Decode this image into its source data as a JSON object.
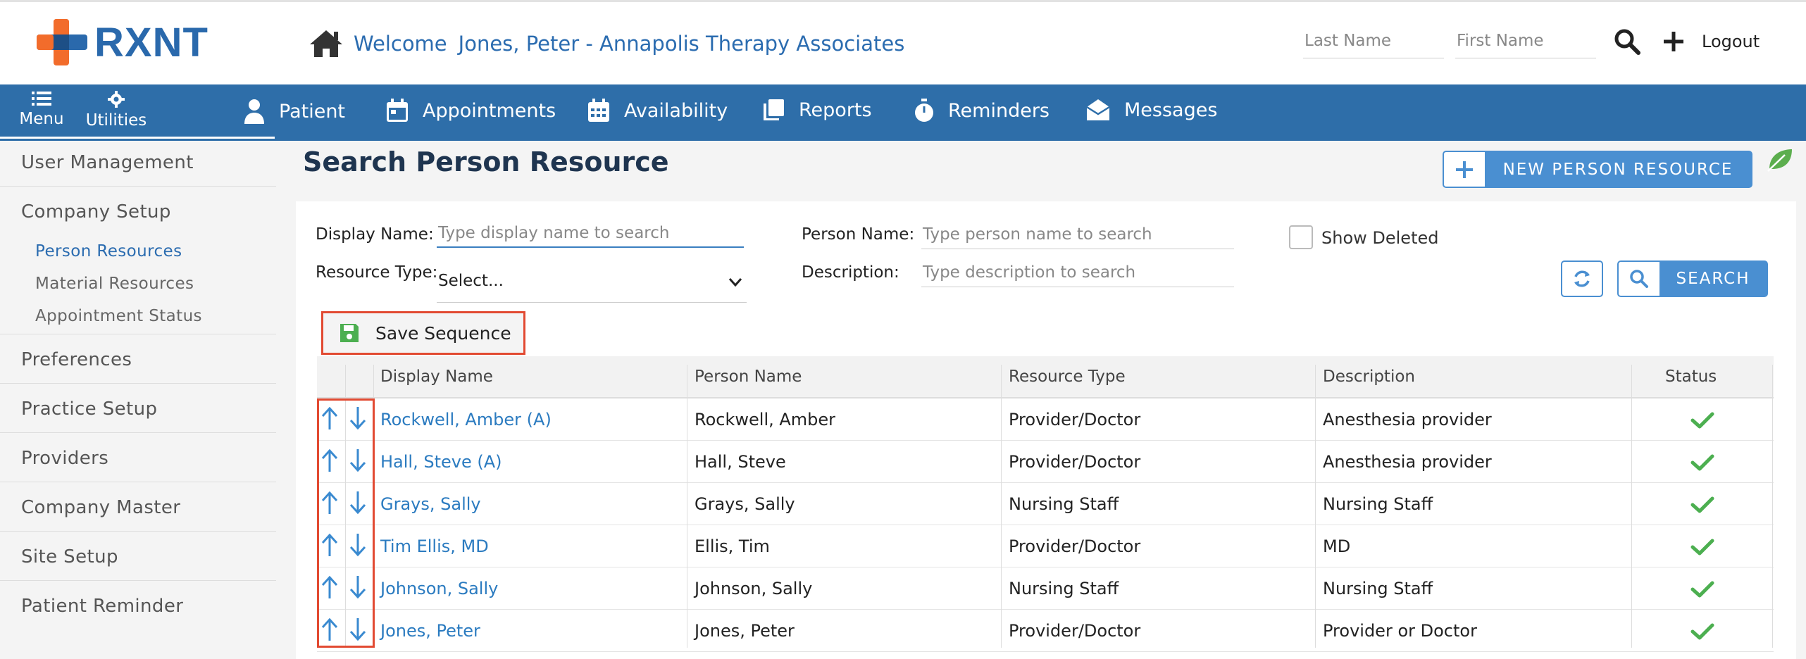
{
  "header": {
    "logo_text": "RXNT",
    "welcome_label": "Welcome",
    "welcome_name": "Jones, Peter - Annapolis Therapy Associates",
    "last_name_placeholder": "Last Name",
    "first_name_placeholder": "First Name",
    "logout_label": "Logout"
  },
  "nav": {
    "menu_label": "Menu",
    "utilities_label": "Utilities",
    "items": [
      {
        "label": "Patient",
        "icon": "person-icon"
      },
      {
        "label": "Appointments",
        "icon": "calendar-icon"
      },
      {
        "label": "Availability",
        "icon": "calendar-grid-icon"
      },
      {
        "label": "Reports",
        "icon": "copy-icon"
      },
      {
        "label": "Reminders",
        "icon": "stopwatch-icon"
      },
      {
        "label": "Messages",
        "icon": "envelope-open-icon"
      }
    ]
  },
  "sidebar": {
    "items": [
      {
        "label": "User Management"
      },
      {
        "label": "Company Setup"
      },
      {
        "label": "Preferences"
      },
      {
        "label": "Practice Setup"
      },
      {
        "label": "Providers"
      },
      {
        "label": "Company Master"
      },
      {
        "label": "Site Setup"
      },
      {
        "label": "Patient Reminder"
      }
    ],
    "company_setup_sub": [
      {
        "label": "Person Resources",
        "active": true
      },
      {
        "label": "Material Resources",
        "active": false
      },
      {
        "label": "Appointment Status",
        "active": false
      }
    ]
  },
  "main": {
    "title": "Search Person Resource",
    "new_button_label": "NEW PERSON RESOURCE",
    "filters": {
      "display_name_label": "Display Name:",
      "display_name_placeholder": "Type display name to search",
      "resource_type_label": "Resource Type:",
      "resource_type_value": "Select...",
      "person_name_label": "Person Name:",
      "person_name_placeholder": "Type person name to search",
      "description_label": "Description:",
      "description_placeholder": "Type description to search",
      "show_deleted_label": "Show Deleted"
    },
    "search_label": "SEARCH",
    "save_sequence_label": "Save Sequence",
    "table": {
      "columns": [
        "Display Name",
        "Person Name",
        "Resource Type",
        "Description",
        "Status"
      ],
      "rows": [
        {
          "display_name": "Rockwell, Amber (A)",
          "person_name": "Rockwell, Amber",
          "resource_type": "Provider/Doctor",
          "description": "Anesthesia provider",
          "status": "active"
        },
        {
          "display_name": "Hall, Steve (A)",
          "person_name": "Hall, Steve",
          "resource_type": "Provider/Doctor",
          "description": "Anesthesia provider",
          "status": "active"
        },
        {
          "display_name": "Grays, Sally",
          "person_name": "Grays, Sally",
          "resource_type": "Nursing Staff",
          "description": "Nursing Staff",
          "status": "active"
        },
        {
          "display_name": "Tim Ellis, MD",
          "person_name": "Ellis, Tim",
          "resource_type": "Provider/Doctor",
          "description": "MD",
          "status": "active"
        },
        {
          "display_name": "Johnson, Sally",
          "person_name": "Johnson, Sally",
          "resource_type": "Nursing Staff",
          "description": "Nursing Staff",
          "status": "active"
        },
        {
          "display_name": "Jones, Peter",
          "person_name": "Jones, Peter",
          "resource_type": "Provider/Doctor",
          "description": "Provider or Doctor",
          "status": "active"
        }
      ]
    }
  },
  "colors": {
    "nav_bg": "#2e6ea9",
    "link": "#2b7bc0",
    "highlight": "#e24a32",
    "check": "#4caf50",
    "logo_orange": "#f26c2b",
    "logo_blue": "#2a69ac"
  }
}
